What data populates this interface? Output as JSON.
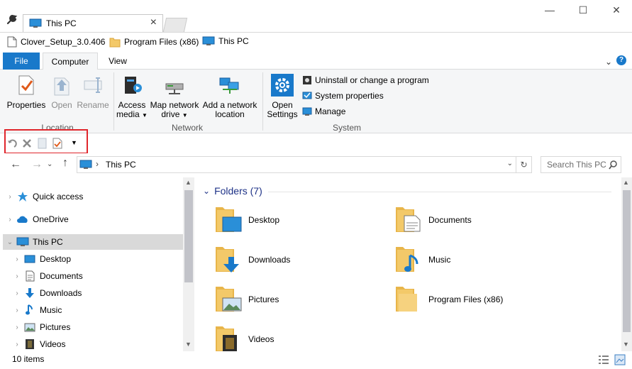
{
  "titlebar": {
    "tab_title": "This PC",
    "close_tab_glyph": "×",
    "window_controls": {
      "minimize": "—",
      "maximize": "☐",
      "close": "✕"
    }
  },
  "bookmarks": [
    {
      "label": "Clover_Setup_3.0.406",
      "icon": "file-icon"
    },
    {
      "label": "Program Files (x86)",
      "icon": "folder-icon"
    },
    {
      "label": "This PC",
      "icon": "computer-icon"
    }
  ],
  "ribbon": {
    "tabs": {
      "file": "File",
      "computer": "Computer",
      "view": "View"
    },
    "location": {
      "label": "Location",
      "properties": "Properties",
      "open": "Open",
      "rename": "Rename"
    },
    "network": {
      "label": "Network",
      "access_media_1": "Access",
      "access_media_2": "media",
      "map_drive_1": "Map network",
      "map_drive_2": "drive",
      "add_location_1": "Add a network",
      "add_location_2": "location"
    },
    "system": {
      "label": "System",
      "open_settings_1": "Open",
      "open_settings_2": "Settings",
      "uninstall": "Uninstall or change a program",
      "system_properties": "System properties",
      "manage": "Manage"
    }
  },
  "address": {
    "path": "This PC",
    "search_placeholder": "Search This PC"
  },
  "nav": {
    "items": [
      {
        "label": "Quick access",
        "icon": "star-icon"
      },
      {
        "label": "OneDrive",
        "icon": "cloud-icon"
      },
      {
        "label": "This PC",
        "icon": "computer-icon"
      },
      {
        "label": "Desktop",
        "icon": "desktop-icon"
      },
      {
        "label": "Documents",
        "icon": "documents-icon"
      },
      {
        "label": "Downloads",
        "icon": "download-icon"
      },
      {
        "label": "Music",
        "icon": "music-icon"
      },
      {
        "label": "Pictures",
        "icon": "pictures-icon"
      },
      {
        "label": "Videos",
        "icon": "videos-icon"
      }
    ]
  },
  "main": {
    "group_title": "Folders (7)",
    "folders": [
      {
        "label": "Desktop",
        "icon": "desktop-folder-icon"
      },
      {
        "label": "Documents",
        "icon": "documents-folder-icon"
      },
      {
        "label": "Downloads",
        "icon": "downloads-folder-icon"
      },
      {
        "label": "Music",
        "icon": "music-folder-icon"
      },
      {
        "label": "Pictures",
        "icon": "pictures-folder-icon"
      },
      {
        "label": "Program Files (x86)",
        "icon": "folder-icon"
      },
      {
        "label": "Videos",
        "icon": "videos-folder-icon"
      }
    ]
  },
  "status": {
    "item_count": "10 items"
  },
  "colors": {
    "accent": "#1979ca",
    "folder": "#f3c969",
    "selection": "#d9d9d9",
    "highlight_box": "#e0262c"
  }
}
